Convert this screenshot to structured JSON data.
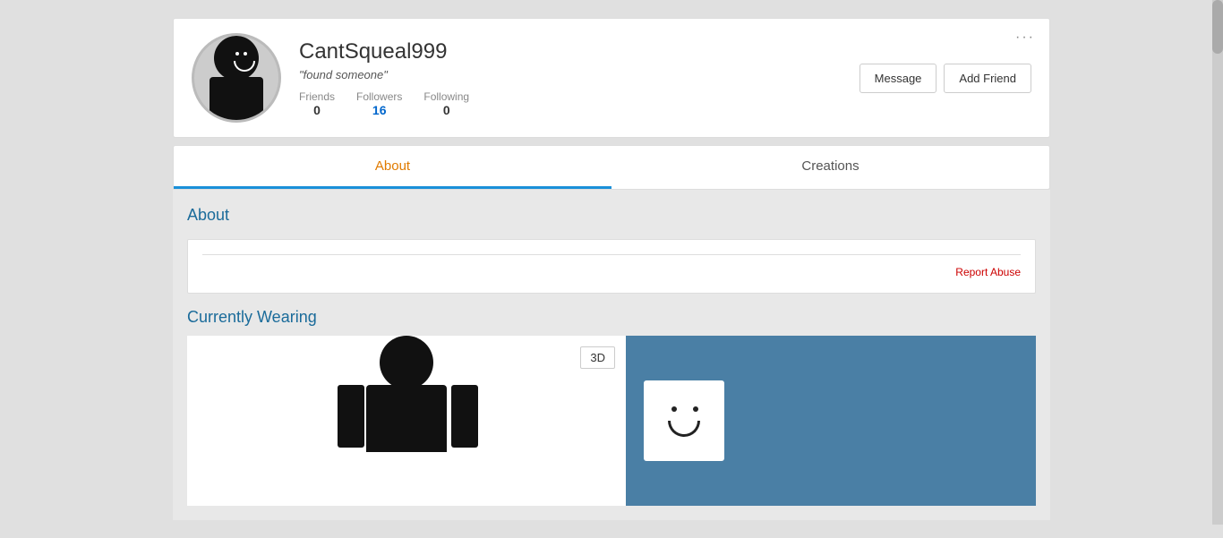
{
  "profile": {
    "username": "CantSqueal999",
    "status": "\"found someone\"",
    "friends_label": "Friends",
    "followers_label": "Followers",
    "following_label": "Following",
    "friends_count": "0",
    "followers_count": "16",
    "following_count": "0",
    "message_btn": "Message",
    "add_friend_btn": "Add Friend",
    "more_dots": "···"
  },
  "tabs": {
    "about_label": "About",
    "creations_label": "Creations"
  },
  "about_section": {
    "heading": "About",
    "report_text": "Report Abuse"
  },
  "wearing_section": {
    "heading": "Currently Wearing",
    "btn_3d": "3D"
  }
}
